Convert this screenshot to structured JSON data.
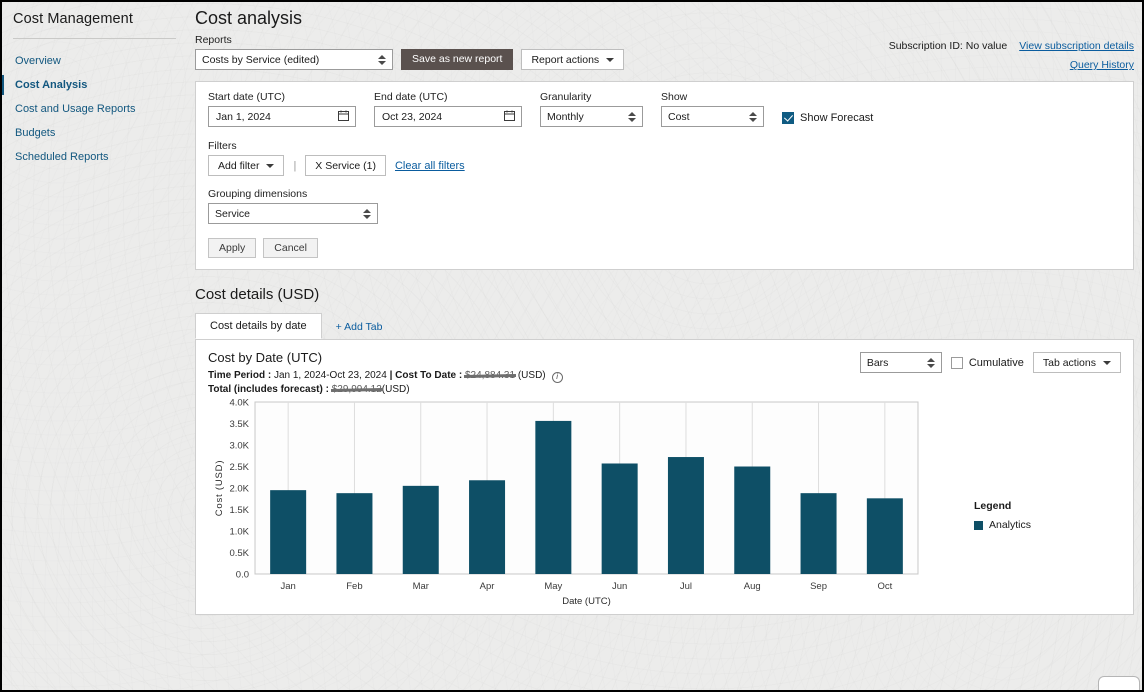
{
  "sidebar": {
    "title": "Cost Management",
    "items": [
      {
        "label": "Overview",
        "active": false
      },
      {
        "label": "Cost Analysis",
        "active": true
      },
      {
        "label": "Cost and Usage Reports",
        "active": false
      },
      {
        "label": "Budgets",
        "active": false
      },
      {
        "label": "Scheduled Reports",
        "active": false
      }
    ]
  },
  "header": {
    "title": "Cost analysis",
    "reports_label": "Reports",
    "report_select_value": "Costs by Service (edited)",
    "save_button": "Save as new report",
    "report_actions_button": "Report actions",
    "subscription_id": "Subscription ID: No value",
    "view_subscription_link": "View subscription details",
    "query_history_link": "Query History"
  },
  "filters": {
    "start_date_label": "Start date (UTC)",
    "start_date_value": "Jan 1, 2024",
    "end_date_label": "End date (UTC)",
    "end_date_value": "Oct 23, 2024",
    "granularity_label": "Granularity",
    "granularity_value": "Monthly",
    "show_label": "Show",
    "show_value": "Cost",
    "show_forecast_label": "Show Forecast",
    "show_forecast_checked": true,
    "filters_label": "Filters",
    "add_filter_button": "Add filter",
    "filter_chip": "X Service (1)",
    "clear_all_link": "Clear all filters",
    "grouping_label": "Grouping dimensions",
    "grouping_value": "Service",
    "apply_button": "Apply",
    "cancel_button": "Cancel"
  },
  "cost_details": {
    "section_title": "Cost details (USD)",
    "tab_label": "Cost details by date",
    "add_tab_label": "+ Add Tab",
    "chart_title": "Cost by Date (UTC)",
    "time_period_prefix": "Time Period",
    "time_period_value": "Jan 1, 2024-Oct 23, 2024",
    "cost_to_date_prefix": "Cost To Date",
    "cost_to_date_value": "$24,884.31",
    "cost_to_date_suffix": "(USD)",
    "total_prefix": "Total (includes forecast)",
    "total_value": "$29,994.12",
    "total_suffix": "(USD)",
    "info_icon": "i",
    "chart_type_value": "Bars",
    "cumulative_label": "Cumulative",
    "cumulative_checked": false,
    "tab_actions_button": "Tab actions"
  },
  "chart_data": {
    "type": "bar",
    "title": "Cost by Date (UTC)",
    "xlabel": "Date (UTC)",
    "ylabel": "Cost (USD)",
    "categories": [
      "Jan",
      "Feb",
      "Mar",
      "Apr",
      "May",
      "Jun",
      "Jul",
      "Aug",
      "Sep",
      "Oct"
    ],
    "values": [
      1950,
      1880,
      2050,
      2180,
      3560,
      2570,
      2720,
      2500,
      1880,
      1760
    ],
    "ylim": [
      0,
      4000
    ],
    "yticks": [
      0,
      500,
      1000,
      1500,
      2000,
      2500,
      3000,
      3500,
      4000
    ],
    "ytick_labels": [
      "0.0",
      "0.5K",
      "1.0K",
      "1.5K",
      "2.0K",
      "2.5K",
      "3.0K",
      "3.5K",
      "4.0K"
    ],
    "grid": true,
    "legend_title": "Legend",
    "legend_position": "right",
    "series": [
      {
        "name": "Analytics",
        "color": "#0e4f66"
      }
    ]
  },
  "colors": {
    "bar": "#0e4f66",
    "accent_link": "#0a5c9e",
    "sidebar_link": "#12577f",
    "save_button": "#5a514e",
    "checkbox": "#0f5b82"
  }
}
